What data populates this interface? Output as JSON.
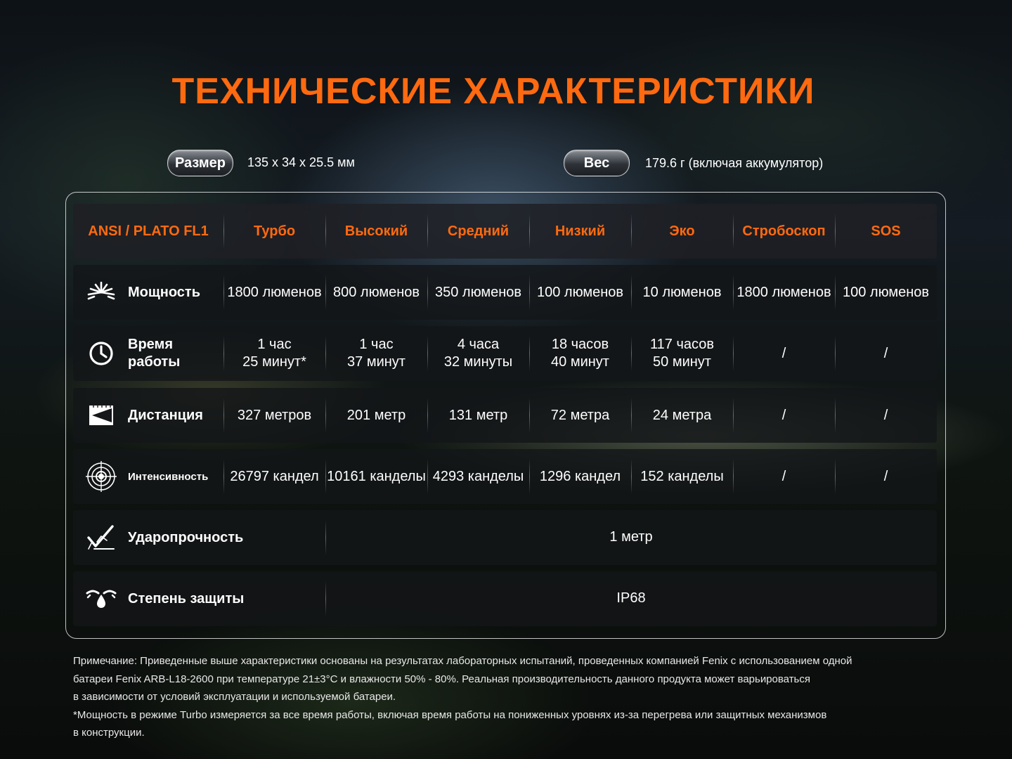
{
  "title": "ТЕХНИЧЕСКИЕ ХАРАКТЕРИСТИКИ",
  "size": {
    "label": "Размер",
    "value": "135 x 34 x 25.5 мм"
  },
  "weight": {
    "label": "Вес",
    "value": "179.6 г (включая аккумулятор)"
  },
  "table": {
    "header": [
      "ANSI / PLATO FL1",
      "Турбо",
      "Высокий",
      "Средний",
      "Низкий",
      "Эко",
      "Стробоскоп",
      "SOS"
    ],
    "power": {
      "label": "Мощность",
      "icon": "burst-icon",
      "values": [
        "1800 люменов",
        "800 люменов",
        "350 люменов",
        "100 люменов",
        "10 люменов",
        "1800 люменов",
        "100 люменов"
      ]
    },
    "runtime": {
      "label_line1": "Время",
      "label_line2": "работы",
      "icon": "clock-icon",
      "values": [
        [
          "1 час",
          "25 минут*"
        ],
        [
          "1 час",
          "37 минут"
        ],
        [
          "4 часа",
          "32 минуты"
        ],
        [
          "18 часов",
          "40 минут"
        ],
        [
          "117 часов",
          "50 минут"
        ],
        [
          "/",
          ""
        ],
        [
          "/",
          ""
        ]
      ]
    },
    "distance": {
      "label": "Дистанция",
      "icon": "distance-icon",
      "values": [
        "327 метров",
        "201 метр",
        "131 метр",
        "72 метра",
        "24 метра",
        "/",
        "/"
      ]
    },
    "intensity": {
      "label": "Интенсивность",
      "icon": "target-icon",
      "values": [
        "26797 кандел",
        "10161 канделы",
        "4293 канделы",
        "1296 кандел",
        "152 канделы",
        "/",
        "/"
      ]
    },
    "impact": {
      "label": "Ударопрочность",
      "icon": "impact-icon",
      "value": "1 метр"
    },
    "protection": {
      "label": "Степень защиты",
      "icon": "water-drop-icon",
      "value": "IP68"
    }
  },
  "notes": [
    "Примечание: Приведенные выше характеристики основаны на результатах лабораторных испытаний, проведенных компанией Fenix с использованием одной",
    "батареи Fenix ARB-L18-2600 при температуре 21±3°C и влажности 50% - 80%. Реальная производительность данного продукта может варьироваться",
    "в зависимости от условий эксплуатации и используемой батареи.",
    "*Мощность в режиме Turbo измеряется за все время работы, включая время работы на пониженных уровнях из-за перегрева или защитных механизмов",
    "в конструкции."
  ],
  "colors": {
    "accent": "#ff6a10",
    "text": "#ffffff",
    "row_bg": "#141619"
  }
}
